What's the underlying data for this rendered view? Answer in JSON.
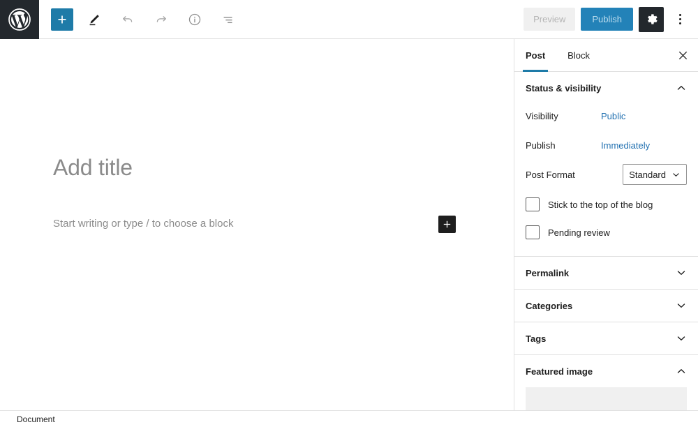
{
  "header": {
    "logo_icon": "wordpress-logo-icon",
    "toolbar": [
      {
        "name": "add-block-button",
        "icon": "plus-icon",
        "label": "Add block"
      },
      {
        "name": "edit-mode-button",
        "icon": "pencil-icon",
        "label": "Edit"
      },
      {
        "name": "undo-button",
        "icon": "undo-arrow-icon",
        "label": "Undo"
      },
      {
        "name": "redo-button",
        "icon": "redo-arrow-icon",
        "label": "Redo"
      },
      {
        "name": "details-button",
        "icon": "info-circle-icon",
        "label": "Details"
      },
      {
        "name": "list-view-button",
        "icon": "list-view-icon",
        "label": "List view"
      }
    ],
    "preview_label": "Preview",
    "publish_label": "Publish",
    "settings_icon": "gear-icon",
    "more_menu_icon": "vertical-dots-icon"
  },
  "editor": {
    "title_placeholder": "Add title",
    "body_placeholder": "Start writing or type / to choose a block",
    "inserter_icon": "plus-icon"
  },
  "sidebar": {
    "tabs": [
      {
        "label": "Post",
        "active": true
      },
      {
        "label": "Block",
        "active": false
      }
    ],
    "close_icon": "close-icon",
    "status_panel": {
      "title": "Status & visibility",
      "chevron": "chevron-up-icon",
      "visibility_label": "Visibility",
      "visibility_value": "Public",
      "publish_label": "Publish",
      "publish_value": "Immediately",
      "post_format_label": "Post Format",
      "post_format_value": "Standard",
      "post_format_chevron": "chevron-down-icon",
      "sticky_label": "Stick to the top of the blog",
      "pending_label": "Pending review"
    },
    "panels": [
      {
        "title": "Permalink",
        "chevron": "chevron-down-icon",
        "expanded": false
      },
      {
        "title": "Categories",
        "chevron": "chevron-down-icon",
        "expanded": false
      },
      {
        "title": "Tags",
        "chevron": "chevron-down-icon",
        "expanded": false
      },
      {
        "title": "Featured image",
        "chevron": "chevron-up-icon",
        "expanded": true
      }
    ]
  },
  "footer": {
    "breadcrumb": "Document"
  },
  "colors": {
    "accent_blue": "#2271b1",
    "publish_blue": "#2382b8",
    "dark": "#23282d",
    "border": "#e0e0e0",
    "placeholder_gray": "#f0f0f0"
  }
}
